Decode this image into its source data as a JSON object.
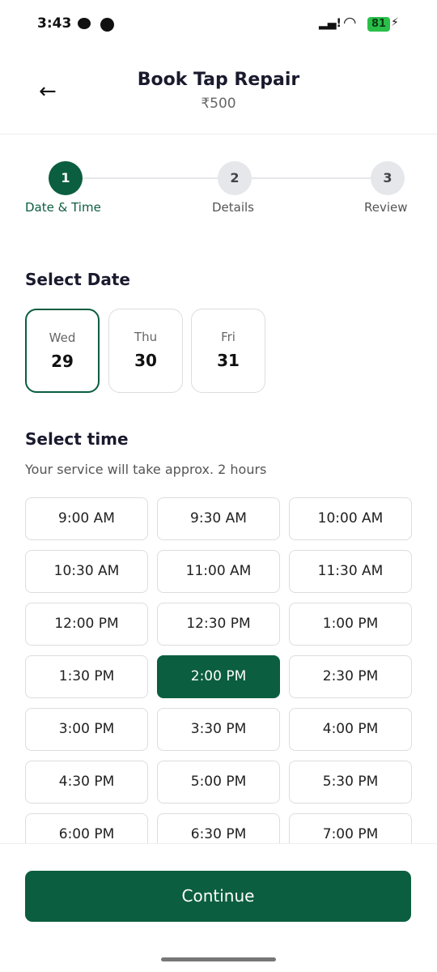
{
  "status": {
    "time": "3:43",
    "battery": "81"
  },
  "header": {
    "title": "Book Tap Repair",
    "price": "₹500"
  },
  "steps": [
    {
      "num": "1",
      "label": "Date & Time"
    },
    {
      "num": "2",
      "label": "Details"
    },
    {
      "num": "3",
      "label": "Review"
    }
  ],
  "date_section": {
    "title": "Select Date",
    "dates": [
      {
        "day": "Wed",
        "num": "29"
      },
      {
        "day": "Thu",
        "num": "30"
      },
      {
        "day": "Fri",
        "num": "31"
      }
    ],
    "selected_index": 0
  },
  "time_section": {
    "title": "Select time",
    "subtitle": "Your service will take approx. 2 hours",
    "slots": [
      "9:00 AM",
      "9:30 AM",
      "10:00 AM",
      "10:30 AM",
      "11:00 AM",
      "11:30 AM",
      "12:00 PM",
      "12:30 PM",
      "1:00 PM",
      "1:30 PM",
      "2:00 PM",
      "2:30 PM",
      "3:00 PM",
      "3:30 PM",
      "4:00 PM",
      "4:30 PM",
      "5:00 PM",
      "5:30 PM",
      "6:00 PM",
      "6:30 PM",
      "7:00 PM"
    ],
    "selected": "2:00 PM"
  },
  "footer": {
    "continue_label": "Continue"
  },
  "colors": {
    "accent": "#0b5e3f"
  }
}
